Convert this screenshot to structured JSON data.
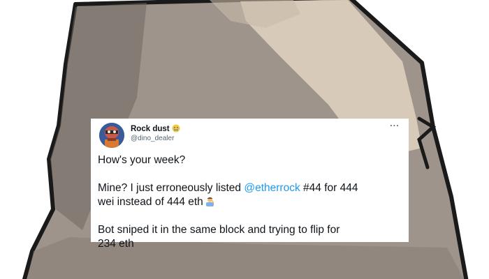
{
  "tweet": {
    "display_name": "Rock dust",
    "name_emoji_icon": "crying-face-icon",
    "handle": "@dino_dealer",
    "more_label": "···",
    "line1": "How's your week?",
    "line2_prefix": "Mine? I just erroneously listed ",
    "mention": "@etherrock",
    "line2_suffix": " #44 for 444",
    "line3": "wei instead of 444 eth",
    "line3_emoji_icon": "person-facepalming-icon",
    "line4": "Bot sniped it in the same block and trying to flip for",
    "line5": "234 eth"
  },
  "colors": {
    "rock_base": "#9e948c",
    "rock_highlight": "#d8cab8",
    "rock_shadow": "#6f6761",
    "rock_outline": "#1a1a1a",
    "link": "#1d9bf0",
    "text_primary": "#0f1419",
    "text_secondary": "#536471"
  }
}
